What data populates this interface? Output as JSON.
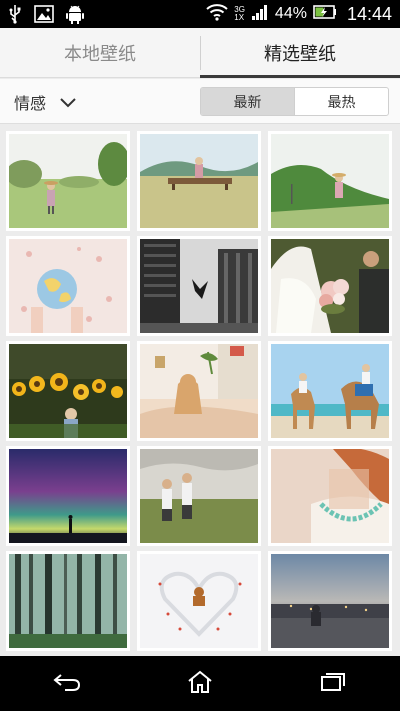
{
  "status_bar": {
    "battery_text": "44%",
    "time": "14:44",
    "network_top": "3G",
    "network_bottom": "1X"
  },
  "tabs": [
    {
      "label": "本地壁纸",
      "active": false
    },
    {
      "label": "精选壁纸",
      "active": true
    }
  ],
  "filter": {
    "category": "情感",
    "sort_options": [
      {
        "label": "最新",
        "selected": true
      },
      {
        "label": "最热",
        "selected": false
      }
    ]
  },
  "wallpapers": [
    {
      "subject": "child-in-field"
    },
    {
      "subject": "child-on-bench"
    },
    {
      "subject": "child-on-hill"
    },
    {
      "subject": "hands-holding-globe"
    },
    {
      "subject": "city-buildings-bw"
    },
    {
      "subject": "bride-with-bouquet"
    },
    {
      "subject": "sunflowers"
    },
    {
      "subject": "girl-on-bed"
    },
    {
      "subject": "couple-on-camels"
    },
    {
      "subject": "aurora-night"
    },
    {
      "subject": "two-kids-field"
    },
    {
      "subject": "woman-necklace"
    },
    {
      "subject": "misty-forest"
    },
    {
      "subject": "dog-heart-snow"
    },
    {
      "subject": "city-dusk-view"
    }
  ],
  "colors": {
    "tab_indicator": "#3a3a3a",
    "status_bar": "#000000",
    "nav_bar": "#000000",
    "grid_background": "#ececec"
  },
  "nav_icons": [
    "back-icon",
    "home-icon",
    "recent-apps-icon"
  ]
}
